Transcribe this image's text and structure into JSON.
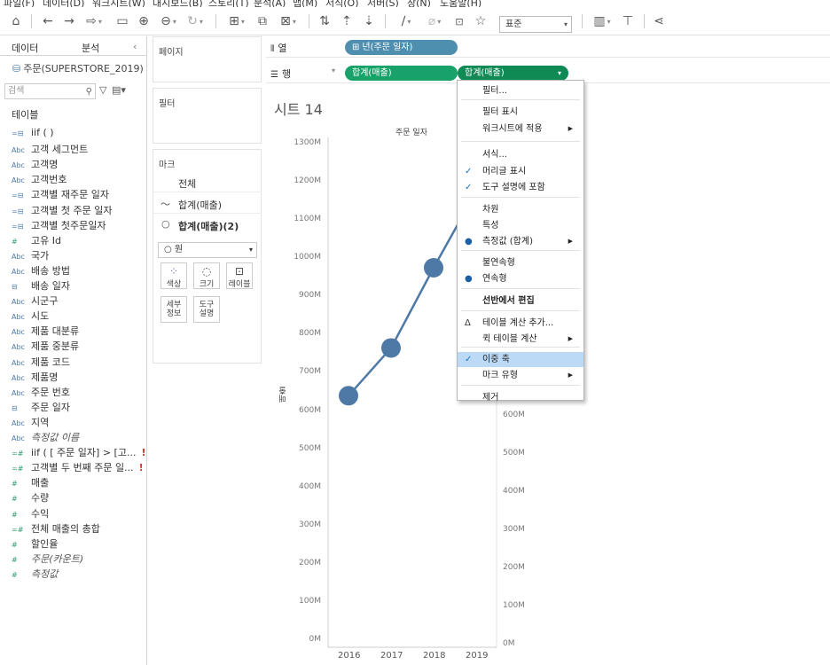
{
  "menu": [
    "파일(F)",
    "데이터(D)",
    "워크시트(W)",
    "대시보드(B)",
    "스토리(T)",
    "분석(A)",
    "맵(M)",
    "서식(O)",
    "서버(S)",
    "창(N)",
    "도움말(H)"
  ],
  "toolbar": {
    "standard_select": "표준"
  },
  "data_pane": {
    "tab_data": "데이터",
    "tab_analysis": "분석",
    "source": "주문(SUPERSTORE_2019)",
    "search_placeholder": "검색",
    "section_table": "테이블",
    "fields": [
      {
        "icon": "=⊟",
        "label": "iif ( )"
      },
      {
        "icon": "Abc",
        "label": "고객 세그먼트"
      },
      {
        "icon": "Abc",
        "label": "고객명"
      },
      {
        "icon": "Abc",
        "label": "고객번호"
      },
      {
        "icon": "=⊟",
        "label": "고객별 재주문 일자"
      },
      {
        "icon": "=⊟",
        "label": "고객별 첫 주문 일자"
      },
      {
        "icon": "=⊟",
        "label": "고객별 첫주문일자"
      },
      {
        "icon": "#",
        "label": "고유 Id"
      },
      {
        "icon": "Abc",
        "label": "국가"
      },
      {
        "icon": "Abc",
        "label": "배송 방법"
      },
      {
        "icon": "⊟",
        "label": "배송 일자"
      },
      {
        "icon": "Abc",
        "label": "시군구"
      },
      {
        "icon": "Abc",
        "label": "시도"
      },
      {
        "icon": "Abc",
        "label": "제품 대분류"
      },
      {
        "icon": "Abc",
        "label": "제품 중분류"
      },
      {
        "icon": "Abc",
        "label": "제품 코드"
      },
      {
        "icon": "Abc",
        "label": "제품명"
      },
      {
        "icon": "Abc",
        "label": "주문 번호"
      },
      {
        "icon": "⊟",
        "label": "주문 일자"
      },
      {
        "icon": "Abc",
        "label": "지역"
      },
      {
        "icon": "Abc",
        "label": "측정값 이름"
      },
      {
        "icon": "=#",
        "label": "iif ( [ 주문 일자] > [고..."
      },
      {
        "icon": "=#",
        "label": "고객별 두 번째 주문 일..."
      },
      {
        "icon": "#",
        "label": "매출"
      },
      {
        "icon": "#",
        "label": "수량"
      },
      {
        "icon": "#",
        "label": "수익"
      },
      {
        "icon": "=#",
        "label": "전체 매출의 총합"
      },
      {
        "icon": "#",
        "label": "할인율"
      },
      {
        "icon": "#",
        "label": "주문(카운트)"
      },
      {
        "icon": "#",
        "label": "측정값"
      }
    ]
  },
  "pages_card": {
    "title": "페이지"
  },
  "filters_card": {
    "title": "필터"
  },
  "marks_card": {
    "title": "마크",
    "all": "전체",
    "row1": "합계(매출)",
    "row2": "합계(매출)(2)",
    "mark_type": "원",
    "buttons": [
      "색상",
      "크기",
      "레이블",
      "세부\n정보",
      "도구\n설명"
    ]
  },
  "shelves": {
    "columns_label": "열",
    "rows_label": "행",
    "column_pill": "년(주문 일자)",
    "row_pill_1": "합계(매출)",
    "row_pill_2": "합계(매출)"
  },
  "view": {
    "sheet_title": "시트 14",
    "column_header": "주문 일자",
    "y_axis_title": "매출",
    "y_ticks_left": [
      "1300M",
      "1200M",
      "1100M",
      "1000M",
      "900M",
      "800M",
      "700M",
      "600M",
      "500M",
      "400M",
      "300M",
      "200M",
      "100M",
      "0M"
    ],
    "y_ticks_right": [
      "600M",
      "500M",
      "400M",
      "300M",
      "200M",
      "100M",
      "0M"
    ],
    "x_ticks": [
      "2016",
      "2017",
      "2018",
      "2019"
    ]
  },
  "chart_data": {
    "type": "line",
    "x": [
      "2016",
      "2017",
      "2018",
      "2019"
    ],
    "series": [
      {
        "values": [
          640,
          765,
          975,
          1175
        ]
      }
    ],
    "ylim": [
      0,
      1300
    ],
    "ylabel": "매출",
    "xlabel": "주문 일자",
    "colors": {
      "line": "#4e79a7",
      "marker": "#4e79a7"
    }
  },
  "context_menu": {
    "items": [
      {
        "label": "필터...",
        "mark": "",
        "submenu": false
      },
      {
        "label": "필터 표시",
        "mark": "",
        "submenu": false
      },
      {
        "label": "워크시트에 적용",
        "mark": "",
        "submenu": true
      },
      {
        "label": "서식...",
        "mark": "",
        "submenu": false
      },
      {
        "label": "머리글 표시",
        "mark": "✓",
        "submenu": false
      },
      {
        "label": "도구 설명에 포함",
        "mark": "✓",
        "submenu": false
      },
      {
        "label": "차원",
        "mark": "",
        "submenu": false
      },
      {
        "label": "특성",
        "mark": "",
        "submenu": false
      },
      {
        "label": "측정값 (합계)",
        "mark": "●",
        "submenu": true
      },
      {
        "label": "불연속형",
        "mark": "",
        "submenu": false
      },
      {
        "label": "연속형",
        "mark": "●",
        "submenu": false
      },
      {
        "label": "선반에서 편집",
        "mark": "",
        "submenu": false
      },
      {
        "label": "테이블 계산 추가...",
        "mark": "Δ",
        "submenu": false
      },
      {
        "label": "퀵 테이블 계산",
        "mark": "",
        "submenu": true
      },
      {
        "label": "이중 축",
        "mark": "✓",
        "submenu": false
      },
      {
        "label": "마크 유형",
        "mark": "",
        "submenu": true
      },
      {
        "label": "제거",
        "mark": "",
        "submenu": false
      }
    ]
  }
}
